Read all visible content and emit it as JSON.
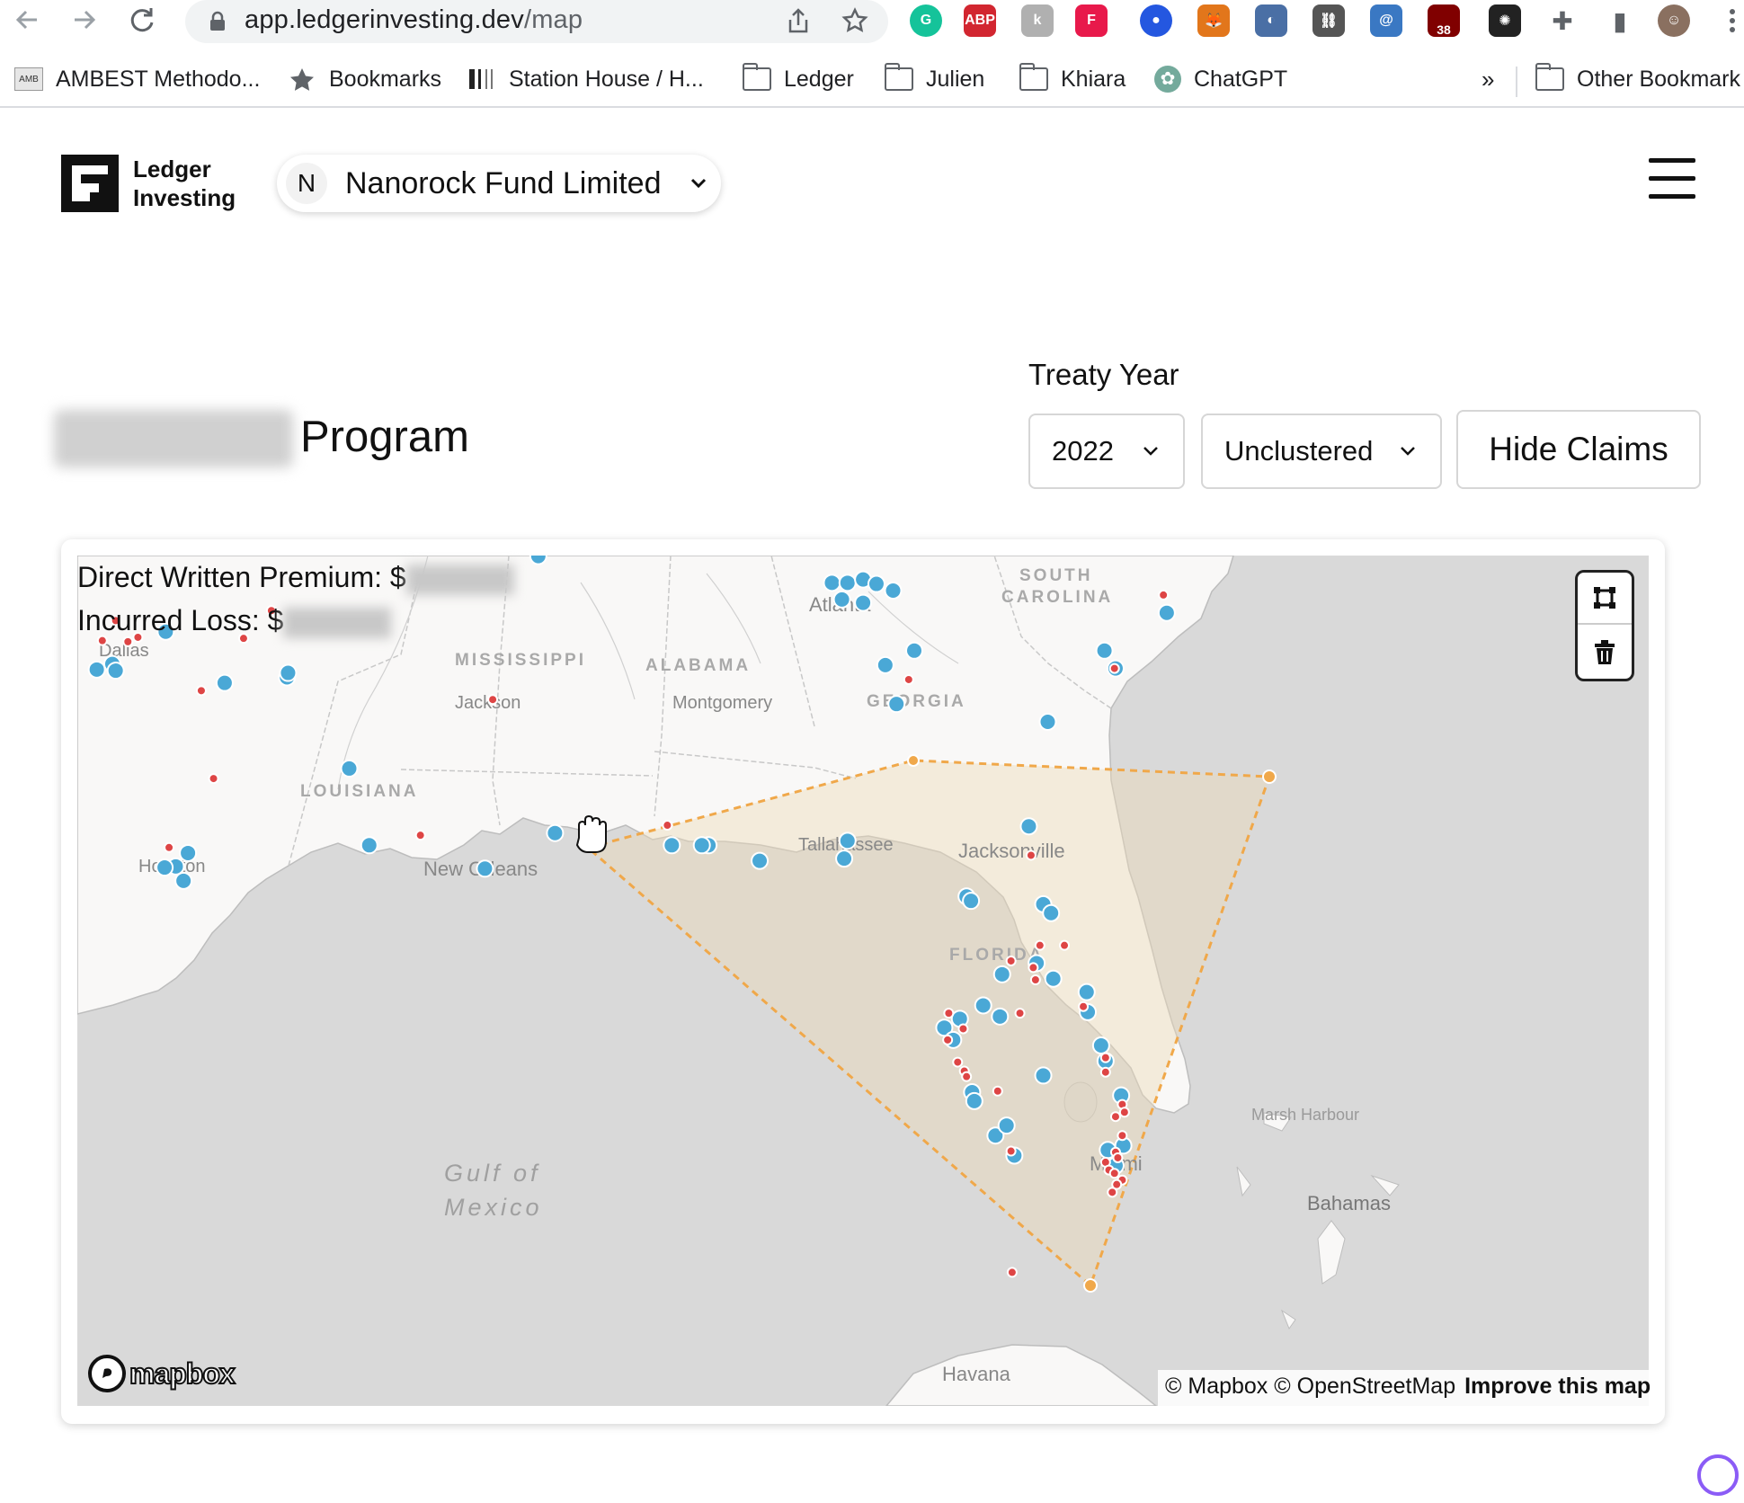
{
  "browser": {
    "url_host": "app.ledgerinvesting.dev",
    "url_path": "/map",
    "extensions": [
      {
        "name": "grammarly-icon",
        "color": "#15c39a",
        "glyph": "G"
      },
      {
        "name": "adblock-icon",
        "color": "#d22630",
        "glyph": "ABP"
      },
      {
        "name": "extension-k-icon",
        "color": "#b0b0b0",
        "glyph": "k"
      },
      {
        "name": "extension-f-icon",
        "color": "#e8194b",
        "glyph": "F"
      },
      {
        "name": "extension-circle-icon",
        "color": "#2457e0",
        "glyph": "●"
      },
      {
        "name": "metamask-icon",
        "color": "#e2761b",
        "glyph": "🦊"
      },
      {
        "name": "extension-moon-icon",
        "color": "#4a6fa5",
        "glyph": "◐"
      },
      {
        "name": "extension-link-icon",
        "color": "#555555",
        "glyph": "⛓"
      },
      {
        "name": "extension-lock-icon",
        "color": "#3a78c3",
        "glyph": "@"
      },
      {
        "name": "ublock-icon",
        "color": "#800000",
        "glyph": "38"
      },
      {
        "name": "extension-spinner-icon",
        "color": "#222222",
        "glyph": "✺"
      },
      {
        "name": "extensions-puzzle-icon",
        "color": "#5f6368",
        "glyph": "✚"
      },
      {
        "name": "sidepanel-icon",
        "color": "#5f6368",
        "glyph": "▮"
      },
      {
        "name": "profile-avatar-icon",
        "color": "#8a7060",
        "glyph": "☺"
      }
    ],
    "ublock_badge": "38"
  },
  "bookmarks": [
    {
      "label": "AMBEST Methodo...",
      "icon": "ambest-icon"
    },
    {
      "label": "Bookmarks",
      "icon": "star-icon"
    },
    {
      "label": "Station House / H...",
      "icon": "station-icon"
    },
    {
      "label": "Ledger",
      "icon": "folder-icon"
    },
    {
      "label": "Julien",
      "icon": "folder-icon"
    },
    {
      "label": "Khiara",
      "icon": "folder-icon"
    },
    {
      "label": "ChatGPT",
      "icon": "chatgpt-icon"
    }
  ],
  "bookmarks_overflow": "»",
  "other_bookmarks": "Other Bookmark",
  "app": {
    "logo_line1": "Ledger",
    "logo_line2": "Investing",
    "fund_avatar": "N",
    "fund_name": "Nanorock Fund Limited"
  },
  "controls": {
    "page_title": "Program",
    "treaty_year_label": "Treaty Year",
    "treaty_year_value": "2022",
    "cluster_value": "Unclustered",
    "hide_claims_label": "Hide Claims"
  },
  "map": {
    "premium_label": "Direct Written Premium: $",
    "loss_label": "Incurred Loss: $",
    "labels": [
      {
        "text": "SOUTH",
        "style": "state"
      },
      {
        "text": "CAROLINA",
        "style": "state"
      },
      {
        "text": "MISSISSIPPI",
        "style": "state"
      },
      {
        "text": "ALABAMA",
        "style": "state"
      },
      {
        "text": "GEORGIA",
        "style": "state"
      },
      {
        "text": "LOUISIANA",
        "style": "state"
      },
      {
        "text": "FLORIDA",
        "style": "state"
      },
      {
        "text": "Jackson",
        "style": "city"
      },
      {
        "text": "Montgomery",
        "style": "city"
      },
      {
        "text": "Houston",
        "style": "city"
      },
      {
        "text": "New Orleans",
        "style": "city"
      },
      {
        "text": "Tallahassee",
        "style": "city"
      },
      {
        "text": "Jacksonville",
        "style": "city"
      },
      {
        "text": "Marsh Harbour",
        "style": "city"
      },
      {
        "text": "Bahamas",
        "style": "city"
      },
      {
        "text": "Miami",
        "style": "city"
      },
      {
        "text": "Havana",
        "style": "city"
      },
      {
        "text": "Dallas",
        "style": "city"
      },
      {
        "text": "Atlanta",
        "style": "city"
      },
      {
        "text": "Gulf of",
        "style": "water"
      },
      {
        "text": "Mexico",
        "style": "water"
      }
    ],
    "attribution": "© Mapbox © OpenStreetMap",
    "improve_link": "Improve this map",
    "mapbox_word": "mapbox",
    "colors": {
      "land": "#f9f8f7",
      "water": "#d6d6d6",
      "policy_marker": "#4aa8d6",
      "claim_marker": "#de4545",
      "polygon_fill": "#efe2cc",
      "polygon_stroke": "#f0a84a"
    }
  }
}
